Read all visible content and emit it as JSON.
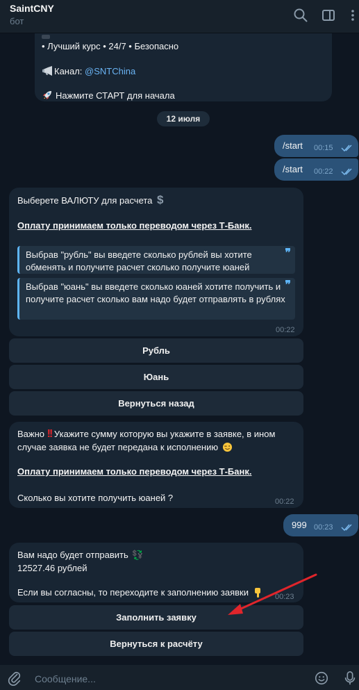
{
  "header": {
    "title": "SaintCNY",
    "subtitle": "бот"
  },
  "messages": {
    "top_partial": {
      "line1": "• Лучший курс • 24/7 • Безопасно",
      "channel_label": "Канал: ",
      "channel_link": "@SNTChina",
      "start_hint": "Нажмите СТАРТ для начала"
    },
    "date_divider": "12 июля",
    "out1": {
      "text": "/start",
      "time": "00:15"
    },
    "out2": {
      "text": "/start",
      "time": "00:22"
    },
    "currency_msg": {
      "title": "Выберете ВАЛЮТУ для расчета",
      "payment_note": "Оплату принимаем только переводом через Т-Банк.",
      "quote1": "Выбрав \"рубль\" вы введете сколько рублей вы хотите обменять и получите расчет сколько получите юаней",
      "quote2": "Выбрав \"юань\" вы введете сколько юаней хотите получить и получите расчет сколько вам надо будет отправлять в рублях",
      "time": "00:22"
    },
    "currency_buttons": [
      "Рубль",
      "Юань",
      "Вернуться назад"
    ],
    "amount_msg": {
      "line1_a": "Важно",
      "line1_b": "Укажите сумму которую вы укажите в заявке, в ином",
      "line2": "случае заявка не будет передана к исполнению",
      "payment_note": "Оплату принимаем только переводом через Т-Банк.",
      "question": "Сколько вы хотите получить юаней ?",
      "time": "00:22"
    },
    "out3": {
      "text": "999",
      "time": "00:23"
    },
    "result_msg": {
      "line1": "Вам надо будет отправить",
      "amount": "12527.46 рублей",
      "line3": "Если вы согласны, то переходите к заполнению заявки",
      "time": "00:23"
    },
    "result_buttons": [
      "Заполнить заявку",
      "Вернуться к расчёту"
    ]
  },
  "composer": {
    "placeholder": "Сообщение..."
  },
  "colors": {
    "background": "#0e1621",
    "incoming_bubble": "#182533",
    "outgoing_bubble": "#2b5278",
    "accent": "#5eb5f7",
    "annotation_arrow": "#e0252b"
  },
  "icons": [
    "search-icon",
    "sidebar-toggle-icon",
    "more-vertical-icon",
    "attach-icon",
    "emoji-icon",
    "microphone-icon",
    "megaphone-icon",
    "rocket-icon",
    "dollar-icon",
    "double-exclamation-icon",
    "wink-icon",
    "money-icon",
    "pointing-down-icon",
    "read-checkmarks-icon"
  ]
}
